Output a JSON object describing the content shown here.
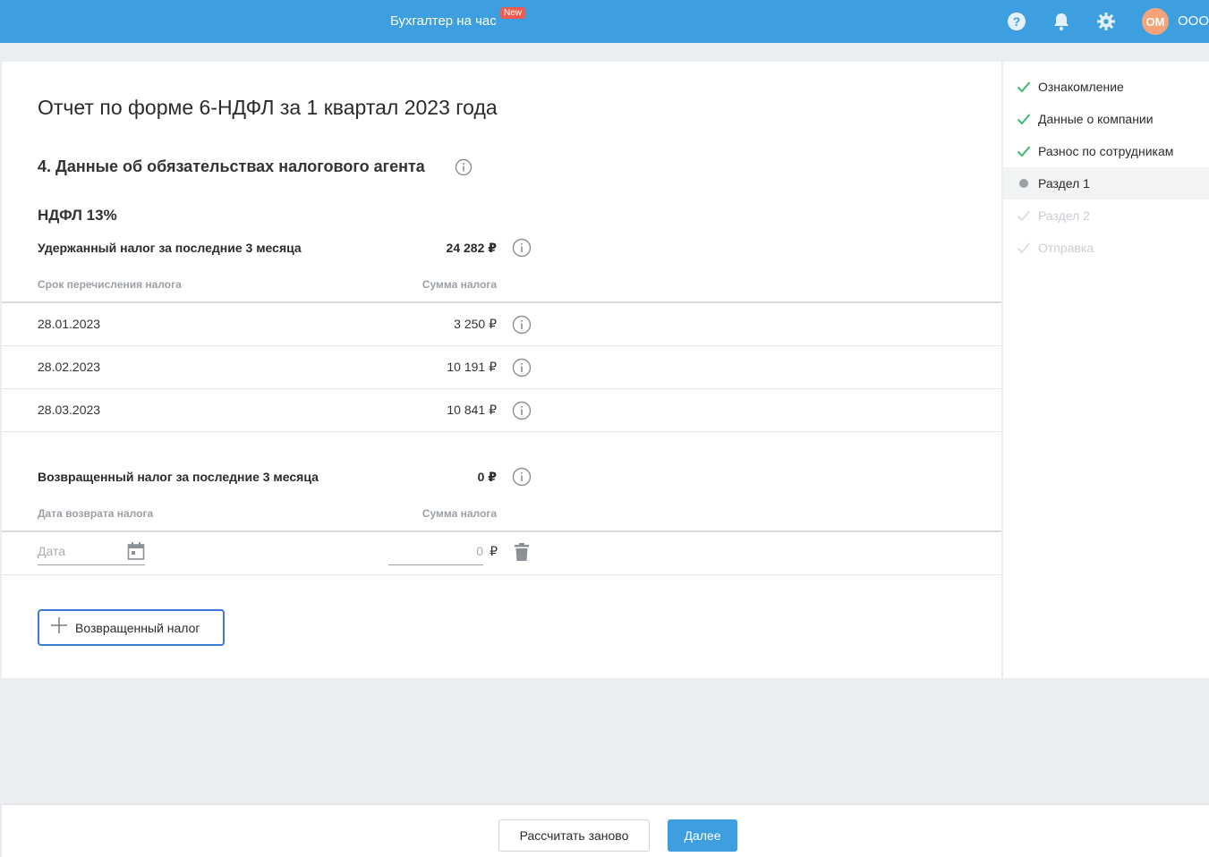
{
  "topbar": {
    "service_label": "Бухгалтер на час",
    "new_badge": "New",
    "avatar_initials": "ОМ",
    "company_name": "ООО",
    "icons": [
      "help-icon",
      "bell-icon",
      "gear-icon"
    ],
    "color": "#3d9fdf"
  },
  "report": {
    "title": "Отчет по форме 6-НДФЛ за 1 квартал 2023 года",
    "section_title": "4. Данные об обязательствах налогового агента",
    "rate_title": "НДФЛ 13%",
    "withheld": {
      "label": "Удержанный налог за последние 3 месяца",
      "total": "24 282 ₽",
      "col_date": "Срок перечисления налога",
      "col_sum": "Сумма налога",
      "rows": [
        {
          "date": "28.01.2023",
          "sum": "3 250 ₽"
        },
        {
          "date": "28.02.2023",
          "sum": "10 191 ₽"
        },
        {
          "date": "28.03.2023",
          "sum": "10 841 ₽"
        }
      ]
    },
    "returned": {
      "label": "Возвращенный налог за последние 3 месяца",
      "total": "0 ₽",
      "col_date": "Дата возврата налога",
      "col_sum": "Сумма налога",
      "date_placeholder": "Дата",
      "sum_value": "0",
      "currency": "₽"
    },
    "add_button": "Возвращенный налог"
  },
  "steps": [
    {
      "label": "Ознакомление",
      "state": "done"
    },
    {
      "label": "Данные о компании",
      "state": "done"
    },
    {
      "label": "Разнос по сотрудникам",
      "state": "done"
    },
    {
      "label": "Раздел 1",
      "state": "active"
    },
    {
      "label": "Раздел 2",
      "state": "disabled"
    },
    {
      "label": "Отправка",
      "state": "disabled"
    }
  ],
  "footer": {
    "recalc_button": "Рассчитать заново",
    "next_button": "Далее"
  }
}
